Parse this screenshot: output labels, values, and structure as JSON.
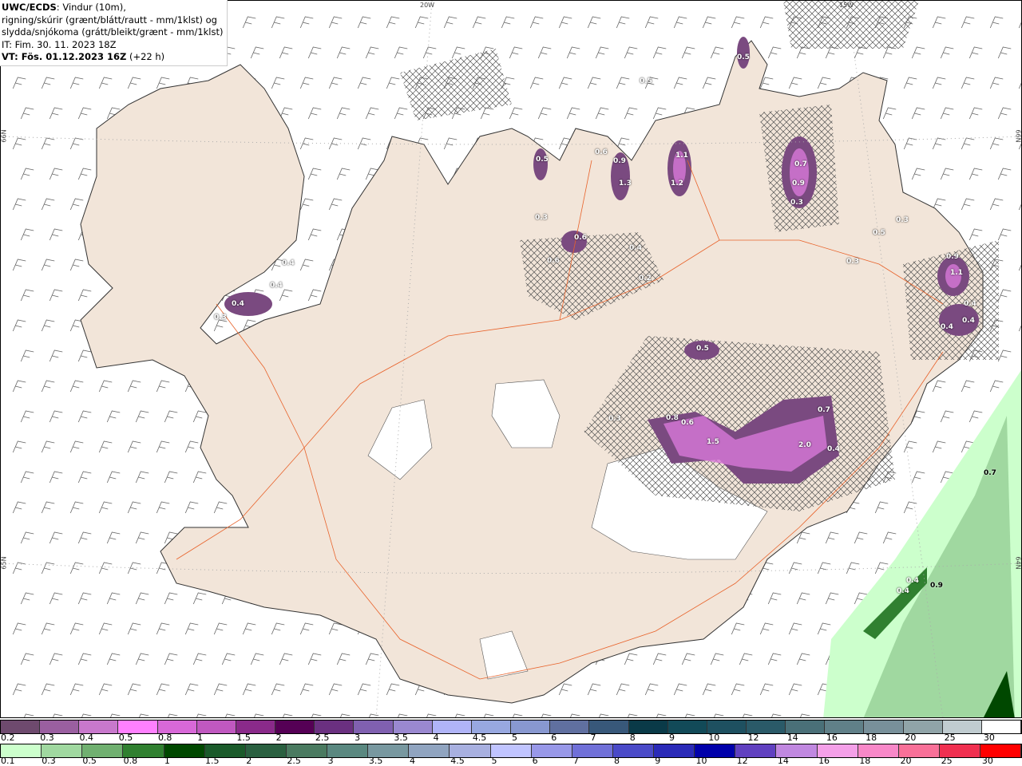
{
  "info": {
    "source": "UWC/ECDS",
    "desc1": ": Vindur (10m),",
    "desc2": "rigning/skúrir (grænt/blátt/rautt - mm/1klst) og",
    "desc3": "slydda/snjókoma (grátt/bleikt/grænt - mm/1klst)",
    "it": "IT: Fim. 30. 11. 2023 18Z",
    "vt": "VT: Fös. 01.12.2023 16Z",
    "vt_offset": " (+22 h)"
  },
  "graticule": {
    "lon1": "20W",
    "lon2": "15W",
    "lat_left_top": "66N",
    "lat_left_bottom": "65N",
    "lat_right_top": "66N",
    "lat_right_bottom": "64N"
  },
  "precip_labels": [
    "0.5",
    "0.5",
    "0.6",
    "0.9",
    "1.1",
    "1.2",
    "1.3",
    "0.7",
    "0.9",
    "0.3",
    "0.5",
    "0.3",
    "0.6",
    "0.4",
    "0.6",
    "0.2",
    "0.3",
    "0.5",
    "0.3",
    "0.9",
    "1.1",
    "0.4",
    "0.4",
    "0.4",
    "0.4",
    "0.4",
    "0.4",
    "0.3",
    "0.5",
    "0.3",
    "0.8",
    "0.6",
    "1.5",
    "0.7",
    "2.0",
    "0.4",
    "0.7",
    "0.4",
    "0.4",
    "0.9"
  ],
  "legend_snow": {
    "labels": [
      "0.2",
      "0.3",
      "0.4",
      "0.5",
      "0.8",
      "1",
      "1.5",
      "2",
      "2.5",
      "3",
      "3.5",
      "4",
      "4.5",
      "5",
      "6",
      "7",
      "8",
      "9",
      "10",
      "12",
      "14",
      "16",
      "18",
      "20",
      "25",
      "30"
    ],
    "colors": [
      "#6e4a6e",
      "#9a5fa0",
      "#c878cc",
      "#ff80ff",
      "#d868d8",
      "#c058c0",
      "#8a2a8a",
      "#550055",
      "#6a3080",
      "#8060b0",
      "#9a88d0",
      "#b0b4f8",
      "#98a8e0",
      "#8898d0",
      "#6070a0",
      "#38587a",
      "#0a3a48",
      "#124a58",
      "#1e5060",
      "#2a5a68",
      "#4a7078",
      "#608088",
      "#78909a",
      "#90a4a8",
      "#c0ccd0",
      "#ffffff"
    ]
  },
  "legend_rain": {
    "labels": [
      "0.1",
      "0.3",
      "0.5",
      "0.8",
      "1",
      "1.5",
      "2",
      "2.5",
      "3",
      "3.5",
      "4",
      "4.5",
      "5",
      "6",
      "7",
      "8",
      "9",
      "10",
      "12",
      "14",
      "16",
      "18",
      "20",
      "25",
      "30"
    ],
    "colors": [
      "#ccffcc",
      "#a0d8a0",
      "#70b070",
      "#308030",
      "#004800",
      "#1a5a2a",
      "#2a6040",
      "#4a7a60",
      "#5a8880",
      "#7898a0",
      "#90a4c0",
      "#a8b0e0",
      "#c0c4ff",
      "#9898e8",
      "#7070d8",
      "#4a4ac8",
      "#2a2ab8",
      "#0000aa",
      "#6040c0",
      "#c088e0",
      "#f4a0e8",
      "#f888c8",
      "#f87098",
      "#f03050",
      "#ff0000"
    ]
  }
}
